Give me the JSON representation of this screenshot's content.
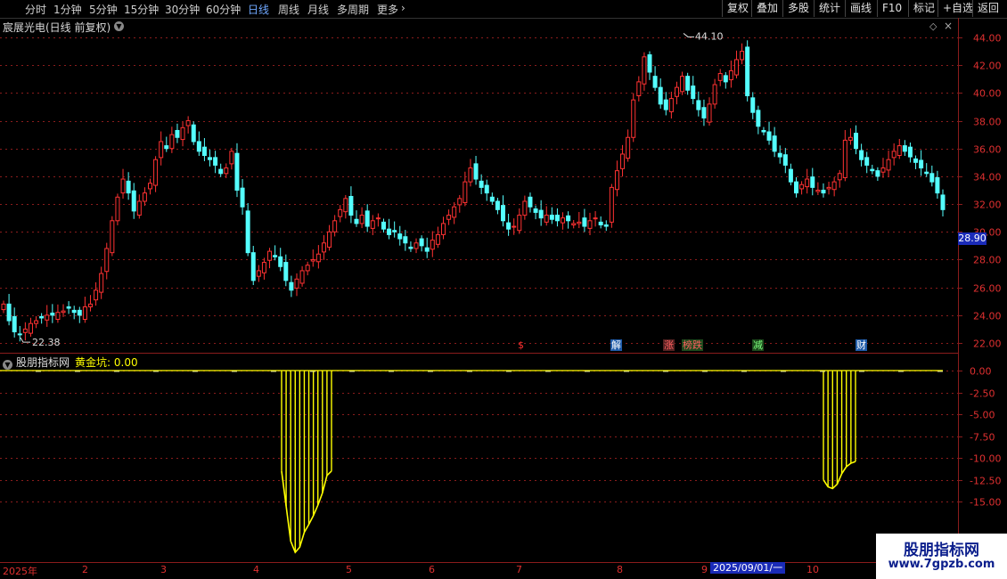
{
  "toolbar": {
    "periods": [
      "分时",
      "1分钟",
      "5分钟",
      "15分钟",
      "30分钟",
      "60分钟",
      "日线",
      "周线",
      "月线",
      "多周期",
      "更多"
    ],
    "active_period": "日线",
    "buttons": [
      "复权",
      "叠加",
      "多股",
      "统计",
      "画线",
      "F10",
      "标记",
      "+自选",
      "返回"
    ]
  },
  "stock_title": "宸展光电(日线 前复权)",
  "price_tag": "28.90",
  "high_label": "44.10",
  "low_label": "22.38",
  "event_markers": [
    "$",
    "解",
    "涨",
    "榜跌",
    "减",
    "财"
  ],
  "indicator": {
    "name": "股朋指标网",
    "line_label": "黄金坑: 0.00"
  },
  "x_axis_labels": [
    "2025年",
    "2",
    "3",
    "4",
    "5",
    "6",
    "7",
    "8",
    "9",
    "10"
  ],
  "cursor_date": "2025/09/01/一",
  "watermark": {
    "title": "股朋指标网",
    "url": "www.7gpzb.com"
  },
  "colors": {
    "up": "#ff3232",
    "down": "#54ffff",
    "indicator": "#ffff00",
    "axis": "#e03030",
    "grid": "#8a1c1c",
    "tag_bg": "#1a2bb8"
  },
  "chart_data": [
    {
      "type": "candlestick",
      "title": "宸展光电(日线 前复权)",
      "y_ticks": [
        22.0,
        24.0,
        26.0,
        28.0,
        30.0,
        32.0,
        34.0,
        36.0,
        38.0,
        40.0,
        42.0,
        44.0
      ],
      "ylim": [
        21.2,
        45.0
      ],
      "high": 44.1,
      "low": 22.38,
      "close_series": [
        24.8,
        23.6,
        22.8,
        22.6,
        23.0,
        23.4,
        23.6,
        23.8,
        24.0,
        24.0,
        24.2,
        24.3,
        24.5,
        24.2,
        24.0,
        24.6,
        24.8,
        25.8,
        27.0,
        28.8,
        30.8,
        32.5,
        33.8,
        32.8,
        31.5,
        32.2,
        32.8,
        33.5,
        35.2,
        36.5,
        36.0,
        37.0,
        36.8,
        37.5,
        38.0,
        36.5,
        35.8,
        35.5,
        35.2,
        34.8,
        34.2,
        34.6,
        35.8,
        33.0,
        31.8,
        28.5,
        26.5,
        27.2,
        27.8,
        28.6,
        28.2,
        27.5,
        26.5,
        25.8,
        26.6,
        27.2,
        27.6,
        28.0,
        28.4,
        29.2,
        30.0,
        30.8,
        31.6,
        32.4,
        31.2,
        30.6,
        31.2,
        30.4,
        30.8,
        31.0,
        30.2,
        29.8,
        30.0,
        29.5,
        29.2,
        28.8,
        29.2,
        29.0,
        28.6,
        29.4,
        29.8,
        30.6,
        31.2,
        31.8,
        32.4,
        33.6,
        34.6,
        33.8,
        33.2,
        32.8,
        32.2,
        31.6,
        30.8,
        30.2,
        30.4,
        31.2,
        32.2,
        31.8,
        31.4,
        31.0,
        31.2,
        30.9,
        30.8,
        31.0,
        30.8,
        30.6,
        30.7,
        30.4,
        30.8,
        31.0,
        30.5,
        30.4,
        33.2,
        34.4,
        35.6,
        36.8,
        39.5,
        40.8,
        42.6,
        41.5,
        40.4,
        39.2,
        38.8,
        39.6,
        40.4,
        41.2,
        40.2,
        39.6,
        38.8,
        38.2,
        39.2,
        40.6,
        41.4,
        40.8,
        41.6,
        42.4,
        43.0,
        39.8,
        38.6,
        37.6,
        37.2,
        36.6,
        35.8,
        35.4,
        34.8,
        33.6,
        32.8,
        33.4,
        33.8,
        33.2,
        33.0,
        32.8,
        33.2,
        33.6,
        34.2,
        36.6,
        36.8,
        36.0,
        35.2,
        34.8,
        34.4,
        34.0,
        34.6,
        35.2,
        35.8,
        36.2,
        35.8,
        35.4,
        35.0,
        34.6,
        34.2,
        33.6,
        32.8,
        31.6
      ],
      "x_labels": [
        "2025年",
        "2",
        "3",
        "4",
        "5",
        "6",
        "7",
        "8",
        "9",
        "10"
      ]
    },
    {
      "type": "bar",
      "title": "股朋指标网",
      "series": [
        {
          "name": "黄金坑",
          "note": "depth values",
          "values": [
            0,
            0,
            0,
            0,
            -11.5,
            -15.5,
            -19.5,
            -18.2,
            -16.0,
            -14.6,
            -13.0,
            -12.0,
            0,
            0,
            -12.0,
            -13.5,
            -13.3,
            -11.0,
            -10.5,
            0
          ]
        }
      ],
      "y_ticks": [
        0.0,
        -2.5,
        -5.0,
        -7.5,
        -10.0,
        -12.5,
        -15.0
      ],
      "ylim": [
        -21.5,
        1.5
      ]
    }
  ]
}
